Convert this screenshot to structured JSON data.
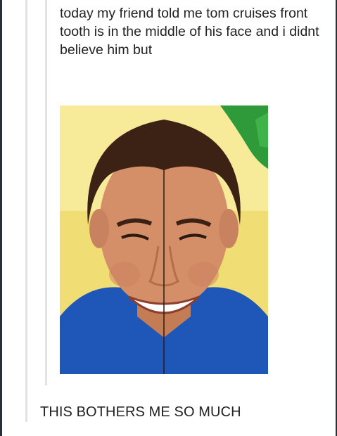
{
  "post": {
    "caption": "today my friend told me tom cruises front tooth is in the middle of his face and i didnt believe him but",
    "footer": "THIS BOTHERS ME SO MUCH"
  },
  "photo": {
    "subject": "mirrored-face-portrait",
    "colors": {
      "background": "#f3e27a",
      "shirt": "#1f57b8",
      "skin": "#d58f68",
      "hair": "#3b2214",
      "center_line": "#2b1a14",
      "accent_green": "#2f9a3a"
    }
  }
}
